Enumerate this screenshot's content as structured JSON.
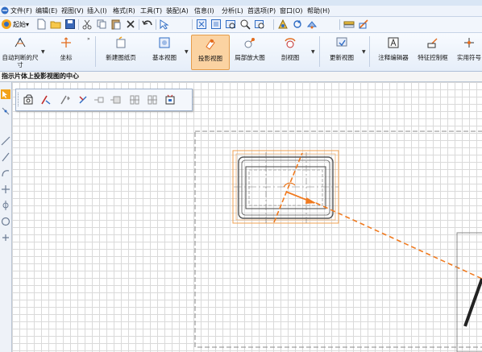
{
  "menu": {
    "items": [
      "文件(F)",
      "编辑(E)",
      "视图(V)",
      "插入(I)",
      "格式(R)",
      "工具(T)",
      "装配(A)",
      "信息(I)",
      "分析(L)",
      "首选项(P)",
      "窗口(O)",
      "帮助(H)"
    ]
  },
  "quickbar": {
    "start_label": "起始▾"
  },
  "ribbon": {
    "auto_dimension_label": "自动判断的尺\n寸",
    "coordinate_label": "坐标",
    "new_sheet_label": "新建图纸页",
    "base_view_label": "基本视图",
    "projected_view_label": "投影视图",
    "detail_view_label": "局部放大图",
    "section_view_label": "剖视图",
    "update_view_label": "更新视图",
    "note_editor_label": "注释编辑器",
    "feature_control_label": "特征控制框",
    "utility_label": "实用符号"
  },
  "hint": {
    "text": "指示片体上投影视图的中心"
  },
  "colors": {
    "preview_orange": "#f07a1f",
    "parent_box": "#f0a050",
    "active_button": "#fbd3a2",
    "grid": "#dadada",
    "sheet_border": "#888888"
  }
}
